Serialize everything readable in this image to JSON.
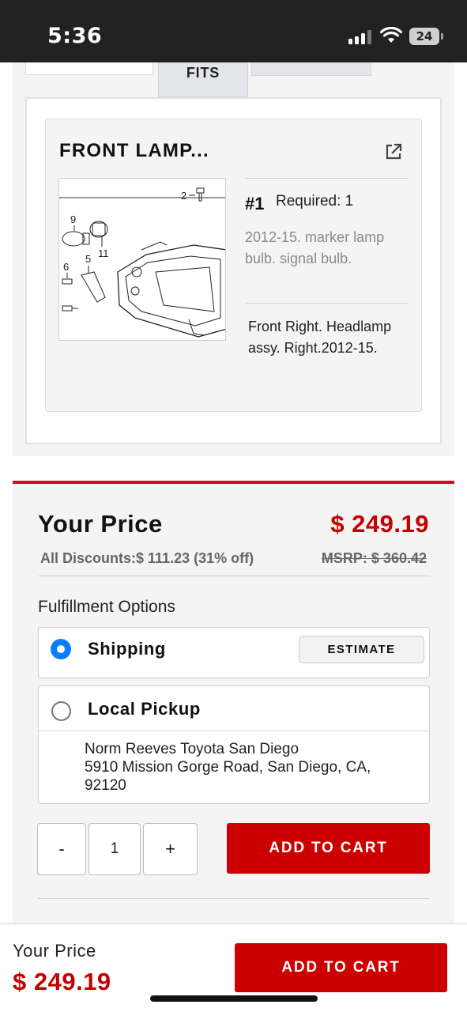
{
  "status_bar": {
    "time": "5:36",
    "battery": "24"
  },
  "tabs": {
    "fits_label": "FITS"
  },
  "part": {
    "title": "FRONT LAMP...",
    "callout": "#1",
    "required": "Required: 1",
    "description": "2012-15. marker lamp bulb. signal bulb.",
    "fitment": "Front Right. Headlamp assy. Right.2012-15.",
    "diagram_labels": {
      "l2": "2",
      "l9": "9",
      "l11": "11",
      "l6": "6",
      "l5": "5"
    }
  },
  "pricing": {
    "label": "Your Price",
    "price": "$ 249.19",
    "discounts": "All Discounts:$ 111.23 (31% off)",
    "msrp": "MSRP: $ 360.42"
  },
  "fulfillment": {
    "heading": "Fulfillment Options",
    "shipping_label": "Shipping",
    "estimate_label": "ESTIMATE",
    "pickup_label": "Local Pickup",
    "store_name": "Norm Reeves Toyota San Diego",
    "store_address_line1": "5910 Mission Gorge Road, San Diego, CA,",
    "store_address_line2": "92120",
    "selected": "Shipping"
  },
  "quantity": {
    "minus": "-",
    "value": "1",
    "plus": "+"
  },
  "add_to_cart_label": "ADD TO CART",
  "sticky": {
    "label": "Your Price",
    "price": "$ 249.19",
    "cart_label": "ADD TO CART"
  },
  "colors": {
    "accent_red": "#cc0000",
    "radio_blue": "#0a7cff"
  },
  "icons": [
    "signal-icon",
    "wifi-icon",
    "battery-icon",
    "external-link-icon",
    "radio-selected-icon",
    "radio-unselected-icon"
  ]
}
